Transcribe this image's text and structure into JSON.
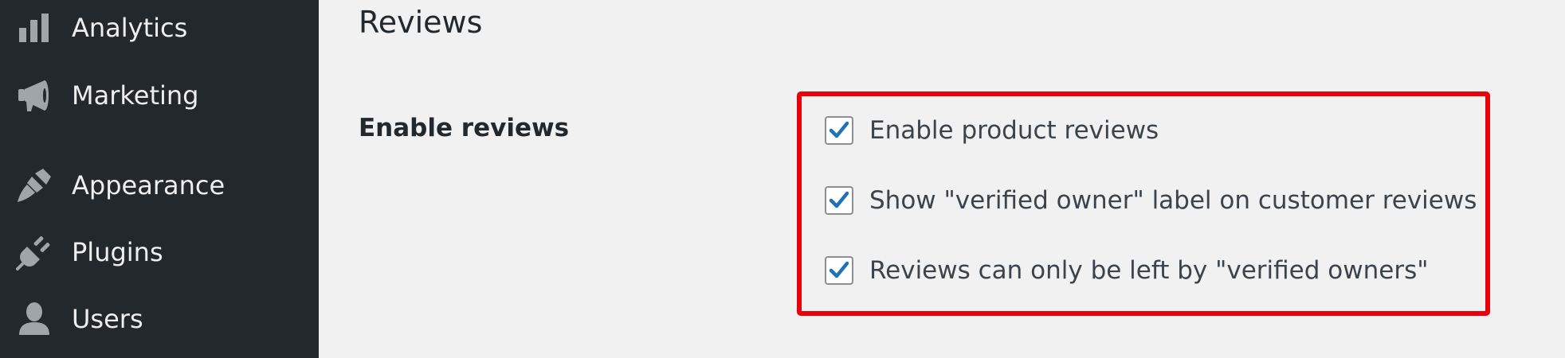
{
  "sidebar": {
    "items": [
      {
        "label": "Analytics",
        "icon": "bar-chart-icon"
      },
      {
        "label": "Marketing",
        "icon": "megaphone-icon"
      },
      {
        "label": "Appearance",
        "icon": "paintbrush-icon"
      },
      {
        "label": "Plugins",
        "icon": "plug-icon"
      },
      {
        "label": "Users",
        "icon": "user-icon"
      }
    ],
    "colors": {
      "background": "#23282d",
      "text": "#eeeeee",
      "icon": "#a0a5aa"
    }
  },
  "main": {
    "section_title": "Reviews",
    "field_label": "Enable reviews",
    "options": [
      {
        "label": "Enable product reviews",
        "checked": true
      },
      {
        "label": "Show \"verified owner\" label on customer reviews",
        "checked": true
      },
      {
        "label": "Reviews can only be left by \"verified owners\"",
        "checked": true
      }
    ],
    "colors": {
      "background": "#f1f1f1",
      "checkmark": "#2271b1",
      "highlight_border": "#e8000b"
    }
  }
}
